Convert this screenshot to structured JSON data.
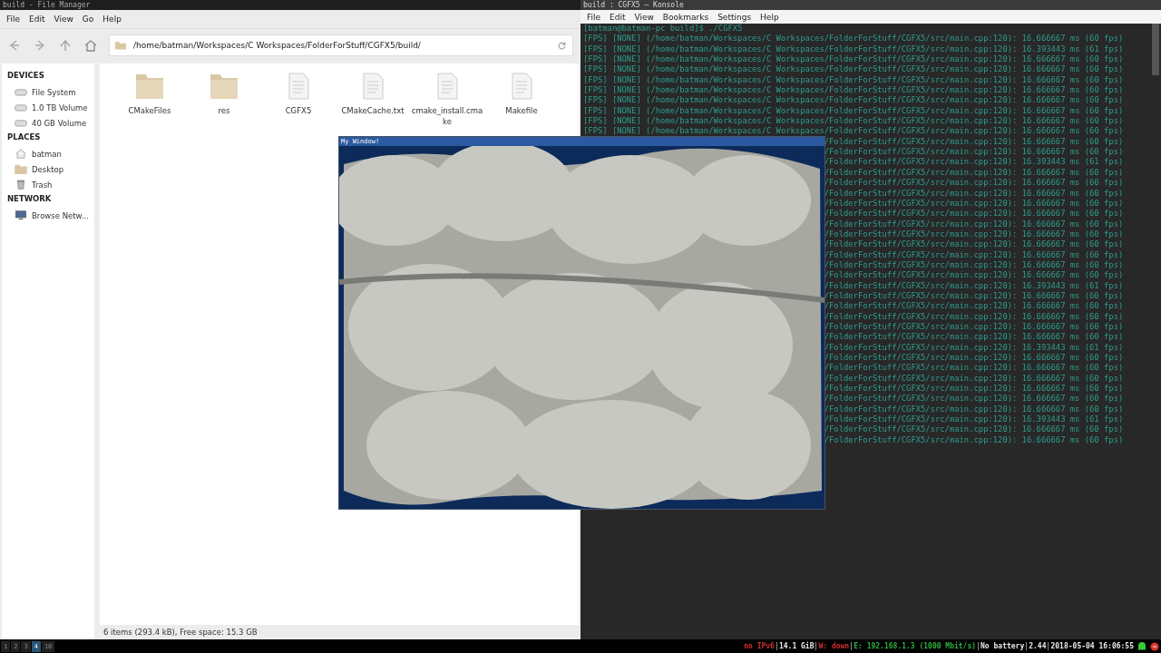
{
  "file_manager": {
    "title": "build - File Manager",
    "menu": [
      "File",
      "Edit",
      "View",
      "Go",
      "Help"
    ],
    "location": "/home/batman/Workspaces/C Workspaces/FolderForStuff/CGFX5/build/",
    "sidebar": [
      {
        "heading": "DEVICES",
        "items": [
          {
            "label": "File System",
            "kind": "drive"
          },
          {
            "label": "1.0 TB Volume",
            "kind": "drive"
          },
          {
            "label": "40 GB Volume",
            "kind": "drive"
          }
        ]
      },
      {
        "heading": "PLACES",
        "items": [
          {
            "label": "batman",
            "kind": "home"
          },
          {
            "label": "Desktop",
            "kind": "folder"
          },
          {
            "label": "Trash",
            "kind": "trash"
          }
        ]
      },
      {
        "heading": "NETWORK",
        "items": [
          {
            "label": "Browse Netw...",
            "kind": "network"
          }
        ]
      }
    ],
    "files": [
      {
        "name": "CMakeFiles",
        "kind": "folder"
      },
      {
        "name": "res",
        "kind": "folder"
      },
      {
        "name": "CGFX5",
        "kind": "file"
      },
      {
        "name": "CMakeCache.txt",
        "kind": "file"
      },
      {
        "name": "cmake_install.cmake",
        "kind": "file"
      },
      {
        "name": "Makefile",
        "kind": "file"
      }
    ],
    "status": "6 items (293.4 kB), Free space: 15.3 GB"
  },
  "konsole": {
    "title": "build : CGFX5 — Konsole",
    "menu": [
      "File",
      "Edit",
      "View",
      "Bookmarks",
      "Settings",
      "Help"
    ],
    "prompt": "[batman@batman-pc build]$ ./CGFX5",
    "lines": [
      {
        "text": "[FPS] [NONE] (/home/batman/Workspaces/C Workspaces/FolderForStuff/CGFX5/src/main.cpp:120): 16.666667 ms (60 fps)",
        "covered": false
      },
      {
        "text": "[FPS] [NONE] (/home/batman/Workspaces/C Workspaces/FolderForStuff/CGFX5/src/main.cpp:120): 16.393443 ms (61 fps)",
        "covered": false
      },
      {
        "text": "[FPS] [NONE] (/home/batman/Workspaces/C Workspaces/FolderForStuff/CGFX5/src/main.cpp:120): 16.666667 ms (60 fps)",
        "covered": false
      },
      {
        "text": "[FPS] [NONE] (/home/batman/Workspaces/C Workspaces/FolderForStuff/CGFX5/src/main.cpp:120): 16.666667 ms (60 fps)",
        "covered": false
      },
      {
        "text": "[FPS] [NONE] (/home/batman/Workspaces/C Workspaces/FolderForStuff/CGFX5/src/main.cpp:120): 16.666667 ms (60 fps)",
        "covered": false
      },
      {
        "text": "[FPS] [NONE] (/home/batman/Workspaces/C Workspaces/FolderForStuff/CGFX5/src/main.cpp:120): 16.666667 ms (60 fps)",
        "covered": false
      },
      {
        "text": "[FPS] [NONE] (/home/batman/Workspaces/C Workspaces/FolderForStuff/CGFX5/src/main.cpp:120): 16.666667 ms (60 fps)",
        "covered": false
      },
      {
        "text": "[FPS] [NONE] (/home/batman/Workspaces/C Workspaces/FolderForStuff/CGFX5/src/main.cpp:120): 16.666667 ms (60 fps)",
        "covered": false
      },
      {
        "text": "[FPS] [NONE] (/home/batman/Workspaces/C Workspaces/FolderForStuff/CGFX5/src/main.cpp:120): 16.666667 ms (60 fps)",
        "covered": false
      },
      {
        "text": "[FPS] [NONE] (/home/batman/Workspaces/C Workspaces/FolderForStuff/CGFX5/src/main.cpp:120): 16.666667 ms (60 fps)",
        "covered": false
      },
      {
        "text": "/FolderForStuff/CGFX5/src/main.cpp:120): 16.666667 ms (60 fps)",
        "covered": true
      },
      {
        "text": "/FolderForStuff/CGFX5/src/main.cpp:120): 16.666667 ms (60 fps)",
        "covered": true
      },
      {
        "text": "/FolderForStuff/CGFX5/src/main.cpp:120): 16.393443 ms (61 fps)",
        "covered": true
      },
      {
        "text": "/FolderForStuff/CGFX5/src/main.cpp:120): 16.666667 ms (60 fps)",
        "covered": true
      },
      {
        "text": "/FolderForStuff/CGFX5/src/main.cpp:120): 16.666667 ms (60 fps)",
        "covered": true
      },
      {
        "text": "/FolderForStuff/CGFX5/src/main.cpp:120): 16.666667 ms (60 fps)",
        "covered": true
      },
      {
        "text": "/FolderForStuff/CGFX5/src/main.cpp:120): 16.666667 ms (60 fps)",
        "covered": true
      },
      {
        "text": "/FolderForStuff/CGFX5/src/main.cpp:120): 16.666667 ms (60 fps)",
        "covered": true
      },
      {
        "text": "/FolderForStuff/CGFX5/src/main.cpp:120): 16.666667 ms (60 fps)",
        "covered": true
      },
      {
        "text": "/FolderForStuff/CGFX5/src/main.cpp:120): 16.666667 ms (60 fps)",
        "covered": true
      },
      {
        "text": "/FolderForStuff/CGFX5/src/main.cpp:120): 16.666667 ms (60 fps)",
        "covered": true
      },
      {
        "text": "/FolderForStuff/CGFX5/src/main.cpp:120): 16.666667 ms (60 fps)",
        "covered": true
      },
      {
        "text": "/FolderForStuff/CGFX5/src/main.cpp:120): 16.666667 ms (60 fps)",
        "covered": true
      },
      {
        "text": "/FolderForStuff/CGFX5/src/main.cpp:120): 16.666667 ms (60 fps)",
        "covered": true
      },
      {
        "text": "/FolderForStuff/CGFX5/src/main.cpp:120): 16.393443 ms (61 fps)",
        "covered": true
      },
      {
        "text": "/FolderForStuff/CGFX5/src/main.cpp:120): 16.666667 ms (60 fps)",
        "covered": true
      },
      {
        "text": "/FolderForStuff/CGFX5/src/main.cpp:120): 16.666667 ms (60 fps)",
        "covered": true
      },
      {
        "text": "/FolderForStuff/CGFX5/src/main.cpp:120): 16.666667 ms (60 fps)",
        "covered": true
      },
      {
        "text": "/FolderForStuff/CGFX5/src/main.cpp:120): 16.666667 ms (60 fps)",
        "covered": true
      },
      {
        "text": "/FolderForStuff/CGFX5/src/main.cpp:120): 16.666667 ms (60 fps)",
        "covered": true
      },
      {
        "text": "/FolderForStuff/CGFX5/src/main.cpp:120): 16.393443 ms (61 fps)",
        "covered": true
      },
      {
        "text": "/FolderForStuff/CGFX5/src/main.cpp:120): 16.666667 ms (60 fps)",
        "covered": true
      },
      {
        "text": "/FolderForStuff/CGFX5/src/main.cpp:120): 16.666667 ms (60 fps)",
        "covered": true
      },
      {
        "text": "/FolderForStuff/CGFX5/src/main.cpp:120): 16.666667 ms (60 fps)",
        "covered": true
      },
      {
        "text": "/FolderForStuff/CGFX5/src/main.cpp:120): 16.666667 ms (60 fps)",
        "covered": true
      },
      {
        "text": "/FolderForStuff/CGFX5/src/main.cpp:120): 16.666667 ms (60 fps)",
        "covered": true
      },
      {
        "text": "/FolderForStuff/CGFX5/src/main.cpp:120): 16.666667 ms (60 fps)",
        "covered": true
      },
      {
        "text": "/FolderForStuff/CGFX5/src/main.cpp:120): 16.393443 ms (61 fps)",
        "covered": true
      },
      {
        "text": "/FolderForStuff/CGFX5/src/main.cpp:120): 16.666667 ms (60 fps)",
        "covered": true
      },
      {
        "text": "/FolderForStuff/CGFX5/src/main.cpp:120): 16.666667 ms (60 fps)",
        "covered": true
      }
    ]
  },
  "game_window": {
    "title": "My Window!",
    "kind": "picture"
  },
  "taskbar": {
    "workspaces": [
      {
        "label": "1",
        "selected": false
      },
      {
        "label": "2",
        "selected": false
      },
      {
        "label": "3",
        "selected": false
      },
      {
        "label": "4",
        "selected": true
      },
      {
        "label": "10",
        "selected": false
      }
    ],
    "status": [
      {
        "text": "no IPv6",
        "color": "#d03030"
      },
      {
        "text": "14.1 GiB",
        "color": "#e8e8e8"
      },
      {
        "text": "W: down",
        "color": "#d03030"
      },
      {
        "text": "E: 192.168.1.3 (1000 Mbit/s)",
        "color": "#30b040"
      },
      {
        "text": "No battery",
        "color": "#e8e8e8"
      },
      {
        "text": "2.44",
        "color": "#e8e8e8"
      },
      {
        "text": "2018-05-04 16:06:55",
        "color": "#e8e8e8"
      }
    ]
  }
}
